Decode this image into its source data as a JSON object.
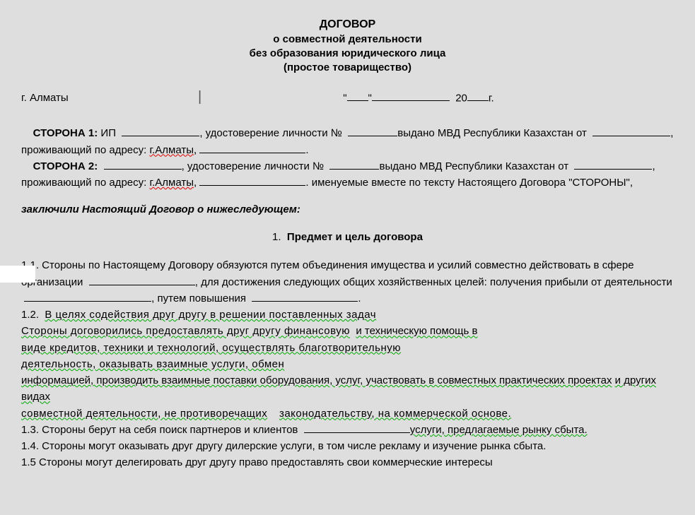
{
  "title": {
    "line1": "ДОГОВОР",
    "line2": "о совместной деятельности",
    "line3": "без образования юридического лица",
    "line4": "(простое товарищество)"
  },
  "meta": {
    "city": "г. Алматы",
    "date_open_quote": "\"",
    "date_close_quote": "\"",
    "year_prefix": "20",
    "year_suffix": "г."
  },
  "parties": {
    "side1_label": "СТОРОНА 1:",
    "side1_prefix": "ИП",
    "id_text": ", удостоверение личности №",
    "issued_text": "выдано МВД Республики Казахстан от",
    "address_text": ", проживающий по адресу:",
    "city_almaty": "г.Алматы",
    "period": ".",
    "side2_label": "СТОРОНА 2:",
    "named_together_prefix": "именуемые вместе по тексту Настоящего Договора \"СТОРОНЫ\","
  },
  "intro": "заключили Настоящий Договор о нижеследующем:",
  "section1": {
    "num": "1.",
    "title": "Предмет и цель договора"
  },
  "clauses": {
    "c11": "1.1. Стороны по Настоящему Договору обязуются путем объединения имущества и усилий совместно действовать в сфере организации",
    "c11b": ", для достижения следующих общих хозяйственных целей: получения прибыли от деятельности",
    "c11c": ", путем повышения",
    "c12a": "1.2.",
    "c12_line1": "В целях содействия друг другу в решении поставленных задач",
    "c12_line2a": "Стороны договорились предоставлять друг другу финансовую",
    "c12_line2b": "и техническую помощь в",
    "c12_line3": "виде кредитов, техники и технологий, осуществлять благотворительную",
    "c12_line4": "деятельность, оказывать взаимные услуги, обмен",
    "c12_line5": "информацией, производить взаимные поставки оборудования, услуг, участвовать в совместных практических проектах",
    "c12_line5b": "и других видах",
    "c12_line6a": "совместной деятельности, не противоречащих",
    "c12_line6b": "законодательству, на коммерческой основе.",
    "c13a": "1.3. Стороны берут на себя поиск партнеров и клиентов",
    "c13b": "услуги, предлагаемые рынку сбыта.",
    "c14": "1.4. Стороны могут оказывать друг другу дилерские услуги, в том числе рекламу и  изучение рынка сбыта.",
    "c15": "1.5 Стороны могут делегировать друг другу право предоставлять свои коммерческие интересы"
  }
}
